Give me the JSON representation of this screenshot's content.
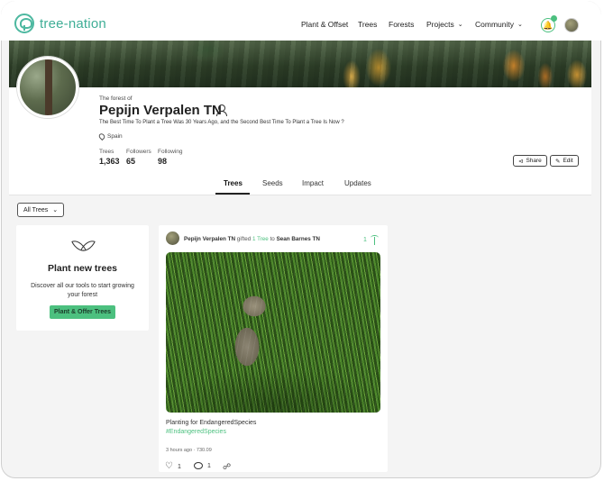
{
  "brand": {
    "logo_text": "tree-nation",
    "accent": "#4cc07f",
    "logo_color": "#3fae96"
  },
  "nav": {
    "items": [
      {
        "label": "Plant & Offset",
        "has_dropdown": false
      },
      {
        "label": "Trees",
        "has_dropdown": false
      },
      {
        "label": "Forests",
        "has_dropdown": false
      },
      {
        "label": "Projects",
        "has_dropdown": true
      },
      {
        "label": "Community",
        "has_dropdown": true
      }
    ],
    "notification_icon": "bell-icon"
  },
  "profile": {
    "forest_of_label": "The forest of",
    "name": "Pepijn Verpalen TN",
    "tagline": "The Best Time To Plant a Tree Was 30 Years Ago, and the Second Best Time To Plant a Tree Is Now ?",
    "location": "Spain",
    "stats": {
      "trees_label": "Trees",
      "trees_value": "1,363",
      "followers_label": "Followers",
      "followers_value": "65",
      "following_label": "Following",
      "following_value": "98"
    },
    "share_label": "Share",
    "edit_label": "Edit"
  },
  "tabs": [
    "Trees",
    "Seeds",
    "Impact",
    "Updates"
  ],
  "active_tab": "Trees",
  "filter": {
    "label": "All Trees"
  },
  "plant_card": {
    "title": "Plant new trees",
    "description": "Discover all our tools to start growing your forest",
    "button_label": "Plant & Offer Trees"
  },
  "feed": {
    "author": "Pepijn Verpalen TN",
    "verb": "gifted",
    "gift": "1 Tree",
    "to_word": "to",
    "recipient": "Sean Barnes TN",
    "tree_count": "1",
    "text": "Planting for EndangeredSpecies",
    "hashtag": "#EndangeredSpecies",
    "meta": "3 hours ago · 730.09",
    "likes": "1",
    "comments": "1"
  }
}
